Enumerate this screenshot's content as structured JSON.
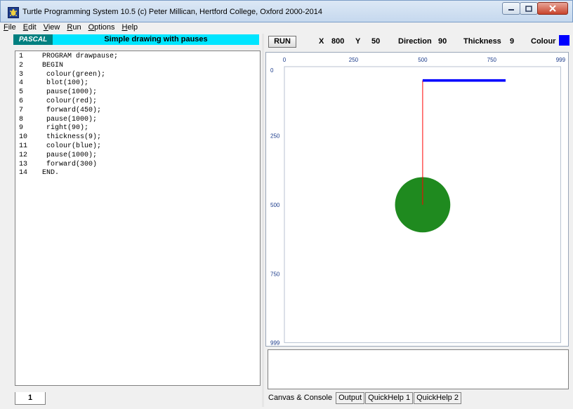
{
  "window": {
    "title": "Turtle Programming System 10.5  (c) Peter Millican, Hertford College, Oxford 2000-2014"
  },
  "menu": [
    {
      "label": "File",
      "accel": "F",
      "rest": "ile"
    },
    {
      "label": "Edit",
      "accel": "E",
      "rest": "dit"
    },
    {
      "label": "View",
      "accel": "V",
      "rest": "iew"
    },
    {
      "label": "Run",
      "accel": "R",
      "rest": "un"
    },
    {
      "label": "Options",
      "accel": "O",
      "rest": "ptions"
    },
    {
      "label": "Help",
      "accel": "H",
      "rest": "elp"
    }
  ],
  "editor": {
    "language": "PASCAL",
    "program_title": "Simple drawing with pauses",
    "lines": [
      {
        "n": "1",
        "code": "  PROGRAM drawpause;"
      },
      {
        "n": "2",
        "code": "  BEGIN"
      },
      {
        "n": "3",
        "code": "   colour(green);"
      },
      {
        "n": "4",
        "code": "   blot(100);"
      },
      {
        "n": "5",
        "code": "   pause(1000);"
      },
      {
        "n": "6",
        "code": "   colour(red);"
      },
      {
        "n": "7",
        "code": "   forward(450);"
      },
      {
        "n": "8",
        "code": "   pause(1000);"
      },
      {
        "n": "9",
        "code": "   right(90);"
      },
      {
        "n": "10",
        "code": "   thickness(9);"
      },
      {
        "n": "11",
        "code": "   colour(blue);"
      },
      {
        "n": "12",
        "code": "   pause(1000);"
      },
      {
        "n": "13",
        "code": "   forward(300)"
      },
      {
        "n": "14",
        "code": "  END."
      }
    ],
    "tab": "1"
  },
  "status": {
    "run_label": "RUN",
    "x_label": "X",
    "x_value": "800",
    "y_label": "Y",
    "y_value": "50",
    "direction_label": "Direction",
    "direction_value": "90",
    "thickness_label": "Thickness",
    "thickness_value": "9",
    "colour_label": "Colour",
    "colour_value": "#0000ff"
  },
  "canvas": {
    "x_ticks": [
      "0",
      "250",
      "500",
      "750",
      "999"
    ],
    "y_ticks": [
      "0",
      "250",
      "500",
      "750",
      "999"
    ],
    "blot": {
      "x": 500,
      "y": 500,
      "radius": 100,
      "color": "#1f8a1f"
    },
    "lines": [
      {
        "x1": 500,
        "y1": 500,
        "x2": 500,
        "y2": 50,
        "color": "#ff0000",
        "thickness": 1
      },
      {
        "x1": 500,
        "y1": 50,
        "x2": 800,
        "y2": 50,
        "color": "#0000ff",
        "thickness": 9
      }
    ]
  },
  "bottom_tabs": [
    "Canvas & Console",
    "Output",
    "QuickHelp 1",
    "QuickHelp 2"
  ]
}
